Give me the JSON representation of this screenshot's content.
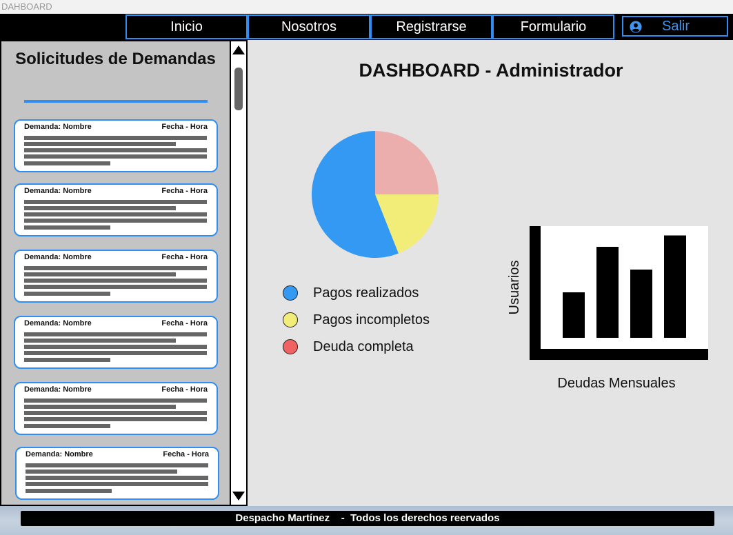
{
  "app": {
    "title": "DAHBOARD"
  },
  "nav": {
    "items": [
      "Inicio",
      "Nosotros",
      "Registrarse",
      "Formulario"
    ],
    "logout": {
      "label": "Salir",
      "icon": "user-circle-icon"
    }
  },
  "sidebar": {
    "title": "Solicitudes de Demandas",
    "cards": [
      {
        "label": "Demanda:  Nombre",
        "date": "Fecha - Hora"
      },
      {
        "label": "Demanda:  Nombre",
        "date": "Fecha - Hora"
      },
      {
        "label": "Demanda:  Nombre",
        "date": "Fecha - Hora"
      },
      {
        "label": "Demanda:  Nombre",
        "date": "Fecha - Hora"
      },
      {
        "label": "Demanda:  Nombre",
        "date": "Fecha - Hora"
      },
      {
        "label": "Demanda:  Nombre",
        "date": "Fecha - Hora"
      }
    ]
  },
  "main": {
    "title": "DASHBOARD - Administrador",
    "legend": [
      {
        "label": "Pagos realizados",
        "color": "#3399f3"
      },
      {
        "label": "Pagos incompletos",
        "color": "#f2ec78"
      },
      {
        "label": "Deuda completa",
        "color": "#f16262"
      }
    ]
  },
  "chart_data": [
    {
      "type": "pie",
      "slices": [
        {
          "value": 25,
          "color": "#ebaeac"
        },
        {
          "value": 19,
          "color": "#f2ec78"
        },
        {
          "value": 56,
          "color": "#3399f3"
        }
      ]
    },
    {
      "type": "bar",
      "ylabel": "Usuarios",
      "xlabel": "Deudas Mensuales",
      "values": [
        40,
        80,
        60,
        90
      ],
      "ylim": [
        0,
        100
      ]
    }
  ],
  "footer": {
    "text": "Despacho Martínez    -  Todos los derechos reervados"
  }
}
